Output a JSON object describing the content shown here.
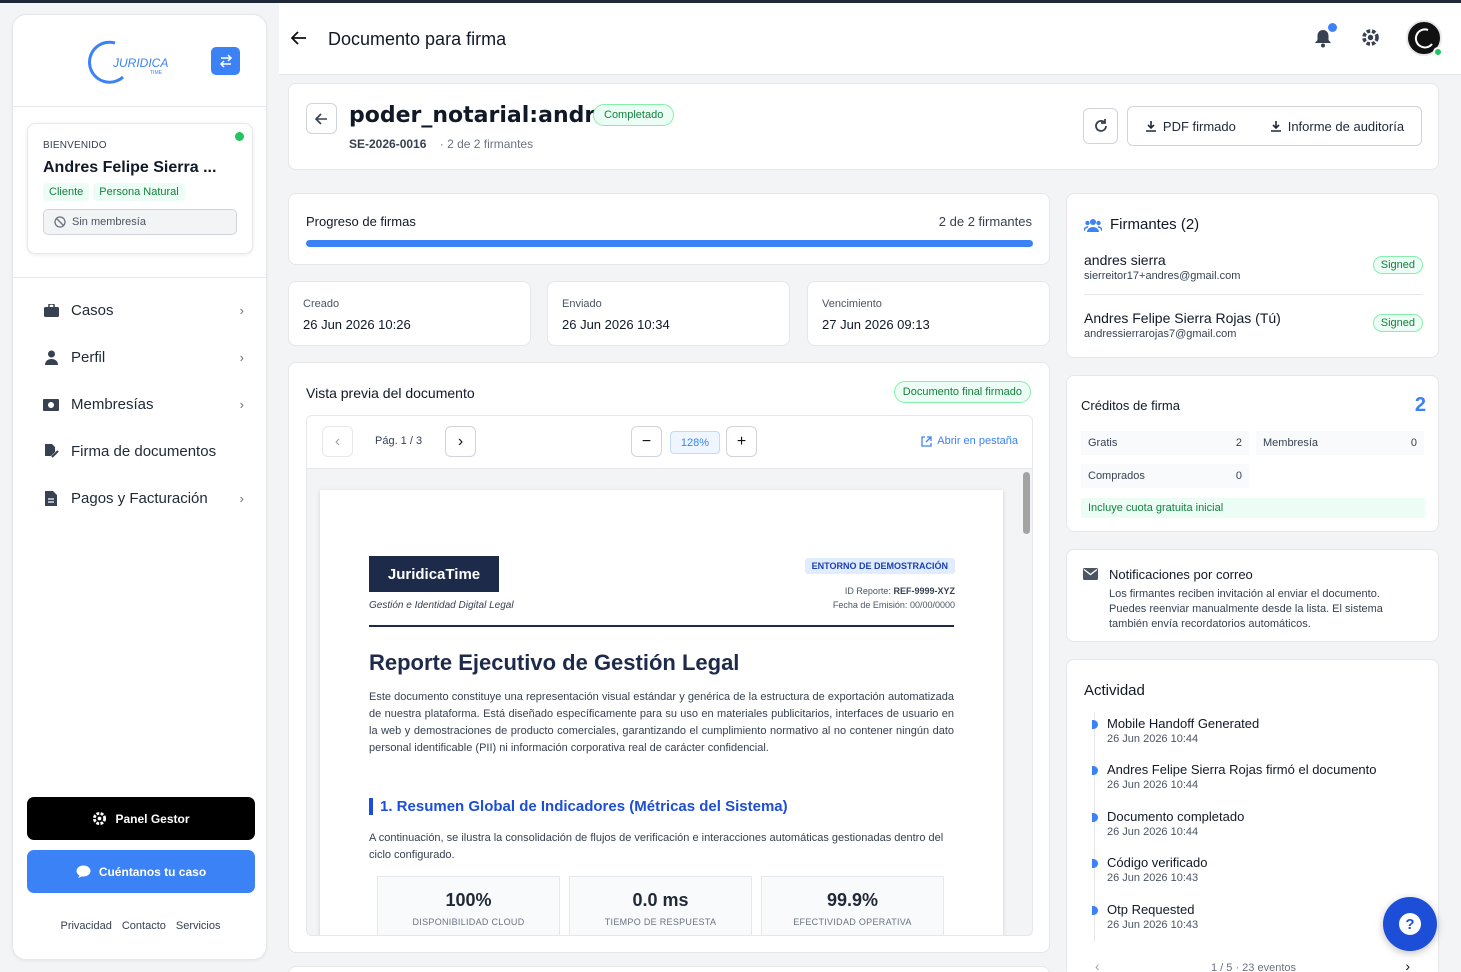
{
  "sidebar": {
    "logo_text": "JURIDICA",
    "logo_sub": "TIME",
    "welcome_label": "BIENVENIDO",
    "user_name": "Andres Felipe Sierra ...",
    "tags": [
      "Cliente",
      "Persona Natural"
    ],
    "membership": "Sin membresía",
    "nav": [
      {
        "label": "Casos",
        "icon": "briefcase-icon"
      },
      {
        "label": "Perfil",
        "icon": "user-icon"
      },
      {
        "label": "Membresías",
        "icon": "money-icon"
      },
      {
        "label": "Firma de documentos",
        "icon": "signature-icon"
      },
      {
        "label": "Pagos y Facturación",
        "icon": "invoice-icon"
      }
    ],
    "panel_button": "Panel Gestor",
    "case_button": "Cuéntanos tu caso",
    "footer_links": [
      "Privacidad",
      "Contacto",
      "Servicios"
    ]
  },
  "header": {
    "title": "Documento para firma"
  },
  "document": {
    "name": "poder_notarial:andres",
    "status": "Completado",
    "code": "SE-2026-0016",
    "signers_summary": "· 2 de 2 firmantes",
    "pdf_button": "PDF firmado",
    "audit_button": "Informe de auditoría"
  },
  "progress": {
    "title": "Progreso de firmas",
    "count": "2 de 2 firmantes",
    "fraction": 1.0
  },
  "dates": [
    {
      "label": "Creado",
      "value": "26 Jun 2026 10:26"
    },
    {
      "label": "Enviado",
      "value": "26 Jun 2026 10:34"
    },
    {
      "label": "Vencimiento",
      "value": "27 Jun 2026 09:13"
    }
  ],
  "preview": {
    "title": "Vista previa del documento",
    "badge": "Documento final firmado",
    "page": "Pág. 1 / 3",
    "zoom": "128%",
    "open_tab": "Abrir en pestaña",
    "pdf": {
      "brand": "JuridicaTime",
      "brand_sub": "Gestión e Identidad Digital Legal",
      "env": "ENTORNO DE DEMOSTRACIÓN",
      "report_id_label": "ID Reporte:",
      "report_id": "REF-9999-XYZ",
      "issue_label": "Fecha de Emisión:",
      "issue_date": "00/00/0000",
      "title": "Reporte Ejecutivo de Gestión Legal",
      "body": "Este documento constituye una representación visual estándar y genérica de la estructura de exportación automatizada de nuestra plataforma. Está diseñado específicamente para su uso en materiales publicitarios, interfaces de usuario en la web y demostraciones de producto comerciales, garantizando el cumplimiento normativo al no contener ningún dato personal identificable (PII) ni información corporativa real de carácter confidencial.",
      "section": "1. Resumen Global de Indicadores (Métricas del Sistema)",
      "section_body": "A continuación, se ilustra la consolidación de flujos de verificación e interacciones automáticas gestionadas dentro del ciclo configurado.",
      "metrics": [
        {
          "value": "100%",
          "label": "DISPONIBILIDAD CLOUD"
        },
        {
          "value": "0.0 ms",
          "label": "TIEMPO DE RESPUESTA"
        },
        {
          "value": "99.9%",
          "label": "EFECTIVIDAD OPERATIVA"
        }
      ]
    }
  },
  "signers": {
    "title": "Firmantes (2)",
    "list": [
      {
        "name": "andres sierra",
        "email": "sierreitor17+andres@gmail.com",
        "status": "Signed"
      },
      {
        "name": "Andres Felipe Sierra Rojas (Tú)",
        "email": "andressierrarojas7@gmail.com",
        "status": "Signed"
      }
    ]
  },
  "credits": {
    "title": "Créditos de firma",
    "total": "2",
    "cells": [
      {
        "label": "Gratis",
        "value": "2"
      },
      {
        "label": "Membresía",
        "value": "0"
      },
      {
        "label": "Comprados",
        "value": "0"
      }
    ],
    "note": "Incluye cuota gratuita inicial"
  },
  "notifications": {
    "title": "Notificaciones por correo",
    "body": "Los firmantes reciben invitación al enviar el documento. Puedes reenviar manualmente desde la lista. El sistema también envía recordatorios automáticos."
  },
  "activity": {
    "title": "Actividad",
    "items": [
      {
        "text": "Mobile Handoff Generated",
        "date": "26 Jun 2026 10:44"
      },
      {
        "text": "Andres Felipe Sierra Rojas firmó el documento",
        "date": "26 Jun 2026 10:44"
      },
      {
        "text": "Documento completado",
        "date": "26 Jun 2026 10:44"
      },
      {
        "text": "Código verificado",
        "date": "26 Jun 2026 10:43"
      },
      {
        "text": "Otp Requested",
        "date": "26 Jun 2026 10:43"
      }
    ],
    "pager": "1 / 5 · 23 eventos"
  },
  "help": {
    "label": "?"
  },
  "colors": {
    "accent": "#3b82f6",
    "success": "#15803d",
    "dark": "#1e2a4a"
  }
}
